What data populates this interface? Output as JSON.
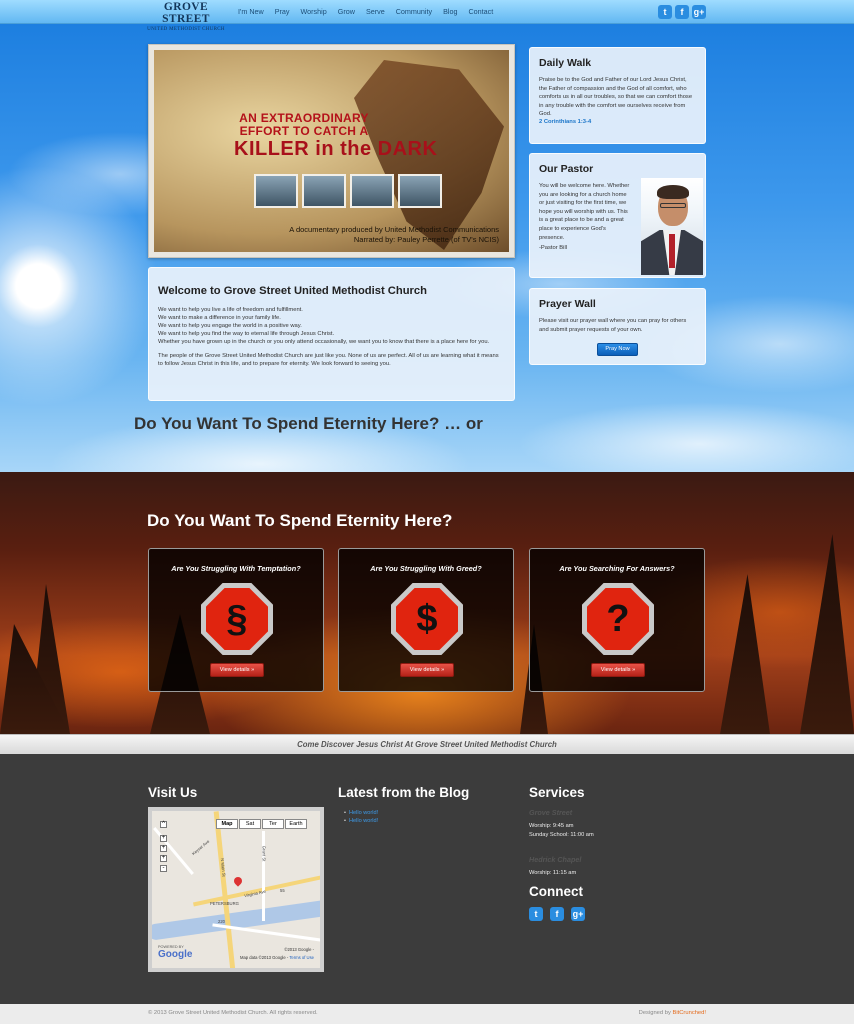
{
  "header": {
    "brand_title": "GROVE STREET",
    "brand_subtitle": "UNITED METHODIST CHURCH",
    "nav": [
      "I'm New",
      "Pray",
      "Worship",
      "Grow",
      "Serve",
      "Community",
      "Blog",
      "Contact"
    ],
    "social": [
      "twitter-icon",
      "facebook-icon",
      "google-plus-icon"
    ]
  },
  "video": {
    "headline_1": "AN EXTRAORDINARY EFFORT TO CATCH A",
    "headline_2": "KILLER in the DARK",
    "credit_1": "A documentary produced by United Methodist Communications",
    "credit_2": "Narrated by: Pauley Perrette (of TV's NCIS)"
  },
  "welcome": {
    "title": "Welcome to Grove Street United Methodist Church",
    "lines": [
      "We want to help you live a life of freedom and fulfillment.",
      "We want to make a difference in your family life.",
      "We want to help you engage the world in a positive way.",
      "We want to help you find the way to eternal life through Jesus Christ.",
      "Whether you have grown up in the church or you only attend occasionally, we want you to know that there is a place here for you."
    ],
    "paragraph_2": "The people of the Grove Street United Methodist Church are just like you. None of us are perfect. All of us are learning what it means to follow Jesus Christ in this life, and to prepare for eternity. We look forward to seeing you."
  },
  "daily_walk": {
    "title": "Daily Walk",
    "text": "Praise be to the God and Father of our Lord Jesus Christ, the Father of compassion and the God of all comfort, who comforts us in all our troubles, so that we can comfort those in any trouble with the comfort we ourselves receive from God.",
    "reference": "2 Corinthians 1:3-4"
  },
  "pastor": {
    "title": "Our Pastor",
    "text": "You will be welcome here. Whether you are looking for a church home or just visiting for the first time, we hope you will worship with us. This is a great place to be and a great place to experience God's presence.",
    "signature": "-Pastor Bill"
  },
  "prayer_wall": {
    "title": "Prayer Wall",
    "text": "Please visit our prayer wall where you can pray for others and submit prayer requests of your own.",
    "button": "Pray Now"
  },
  "sky_heading": "Do You Want To Spend Eternity Here? … or",
  "hell_heading": "Do You Want To Spend Eternity Here?",
  "cards": [
    {
      "title": "Are You Struggling With Temptation?",
      "icon": "serpent-icon",
      "glyph": "§",
      "button": "View details »"
    },
    {
      "title": "Are You Struggling With Greed?",
      "icon": "dollar-icon",
      "glyph": "$",
      "button": "View details »"
    },
    {
      "title": "Are You Searching For Answers?",
      "icon": "question-icon",
      "glyph": "?",
      "button": "View details »"
    }
  ],
  "strip_text": "Come Discover Jesus Christ At Grove Street United Methodist Church",
  "footer": {
    "visit_title": "Visit Us",
    "map": {
      "types": [
        "Map",
        "Sat",
        "Ter",
        "Earth"
      ],
      "labels": [
        "Keyser Ave",
        "N Main St",
        "Virginia Ave",
        "PETERSBURG",
        "Grant St",
        "220",
        "55"
      ],
      "copyright": "©2013 Google -",
      "data": "Map data ©2013 Google -",
      "terms": "Terms of Use",
      "logo": "Google",
      "powered_by": "POWERED BY"
    },
    "blog_title": "Latest from the Blog",
    "blog_items": [
      "Hello world!",
      "Hello world!"
    ],
    "services_title": "Services",
    "locations": [
      {
        "name": "Grove Street",
        "times": [
          "Worship: 9:45 am",
          "Sunday School: 11:00 am"
        ]
      },
      {
        "name": "Hedrick Chapel",
        "times": [
          "Worship: 11:15 am"
        ]
      }
    ],
    "connect_title": "Connect",
    "connect_social": [
      "twitter-icon",
      "facebook-icon",
      "google-plus-icon"
    ]
  },
  "bottom": {
    "copyright": "© 2013 Grove Street United Methodist Church. All rights reserved.",
    "designed_prefix": "Designed by ",
    "designer": "BitCrunched!"
  },
  "colors": {
    "navbar": "#62b8f2",
    "link": "#1c76c9",
    "button_blue": "#0b5fb9",
    "button_red": "#b52218",
    "stop_red": "#e0240f",
    "footer_bg": "#3c3c3c"
  }
}
